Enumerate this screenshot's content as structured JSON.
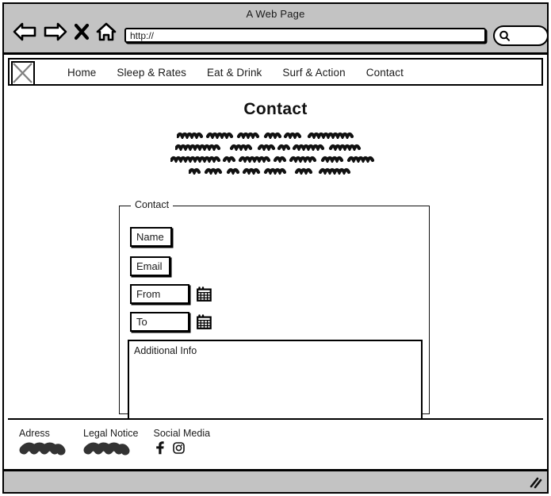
{
  "browser": {
    "window_title": "A Web Page",
    "url_value": "http://",
    "toolbar_icons": [
      "back-arrow-icon",
      "forward-arrow-icon",
      "stop-x-icon",
      "home-icon"
    ],
    "search_placeholder": "",
    "search_icon": "magnifier-icon",
    "resize_grip_icon": "resize-grip-icon"
  },
  "site_nav": {
    "logo_alt": "logo-placeholder",
    "links": [
      {
        "label": "Home"
      },
      {
        "label": "Sleep & Rates"
      },
      {
        "label": "Eat & Drink"
      },
      {
        "label": "Surf & Action"
      },
      {
        "label": "Contact"
      }
    ]
  },
  "main": {
    "title": "Contact",
    "intro_placeholder_lines": 4
  },
  "form": {
    "legend": "Contact",
    "fields": [
      {
        "name": "name-input",
        "value": "Name",
        "type": "text"
      },
      {
        "name": "email-input",
        "value": "Email",
        "type": "text"
      },
      {
        "name": "from-input",
        "value": "From",
        "type": "date"
      },
      {
        "name": "to-input",
        "value": "To",
        "type": "date"
      }
    ],
    "textarea": {
      "value": "Additional Info"
    },
    "calendar_icon": "calendar-icon"
  },
  "footer": {
    "columns": [
      {
        "title": "Adress",
        "content": "scribble"
      },
      {
        "title": "Legal Notice",
        "content": "scribble"
      },
      {
        "title": "Social Media",
        "content": "icons"
      }
    ],
    "social_icons": [
      "facebook-icon",
      "instagram-icon"
    ]
  },
  "colors": {
    "chrome": "#c3c3c3",
    "ink": "#000000",
    "paper": "#ffffff",
    "text": "#1b1b1b"
  }
}
